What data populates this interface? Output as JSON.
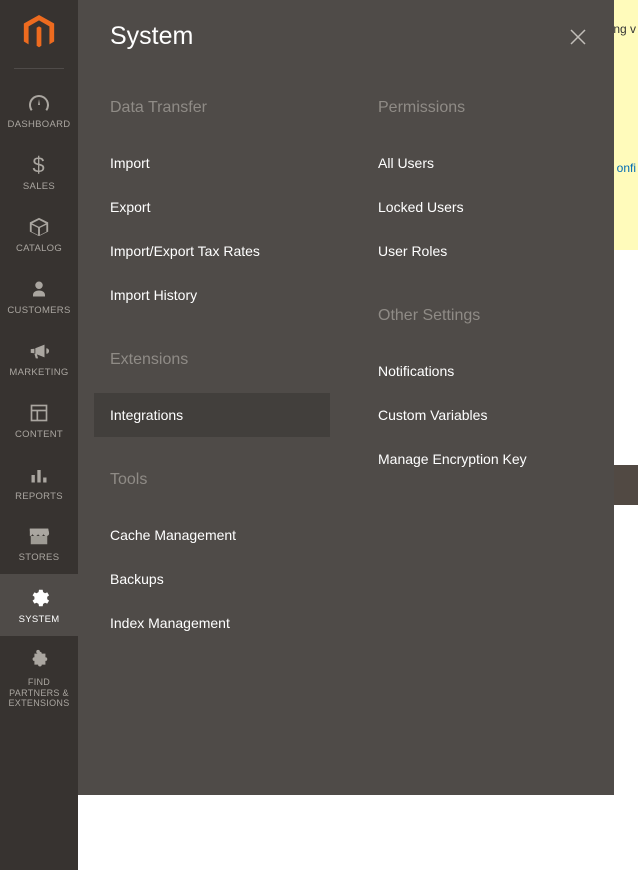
{
  "sidebar": {
    "items": [
      {
        "label": "DASHBOARD"
      },
      {
        "label": "SALES"
      },
      {
        "label": "CATALOG"
      },
      {
        "label": "CUSTOMERS"
      },
      {
        "label": "MARKETING"
      },
      {
        "label": "CONTENT"
      },
      {
        "label": "REPORTS"
      },
      {
        "label": "STORES"
      },
      {
        "label": "SYSTEM"
      },
      {
        "label": "FIND PARTNERS & EXTENSIONS"
      }
    ]
  },
  "flyout": {
    "title": "System",
    "left_sections": [
      {
        "header": "Data Transfer",
        "items": [
          {
            "label": "Import"
          },
          {
            "label": "Export"
          },
          {
            "label": "Import/Export Tax Rates"
          },
          {
            "label": "Import History"
          }
        ]
      },
      {
        "header": "Extensions",
        "items": [
          {
            "label": "Integrations"
          }
        ]
      },
      {
        "header": "Tools",
        "items": [
          {
            "label": "Cache Management"
          },
          {
            "label": "Backups"
          },
          {
            "label": "Index Management"
          }
        ]
      }
    ],
    "right_sections": [
      {
        "header": "Permissions",
        "items": [
          {
            "label": "All Users"
          },
          {
            "label": "Locked Users"
          },
          {
            "label": "User Roles"
          }
        ]
      },
      {
        "header": "Other Settings",
        "items": [
          {
            "label": "Notifications"
          },
          {
            "label": "Custom Variables"
          },
          {
            "label": "Manage Encryption Key"
          }
        ]
      }
    ]
  },
  "bg": {
    "text1": "ng v",
    "link": "onfi"
  }
}
